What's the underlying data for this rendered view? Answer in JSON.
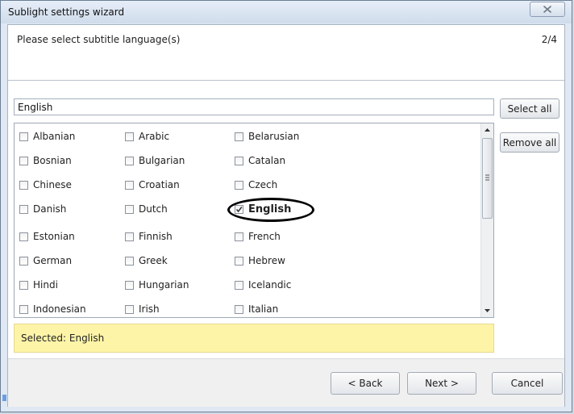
{
  "window": {
    "title": "Sublight settings wizard"
  },
  "header": {
    "text": "Please select subtitle language(s)",
    "step": "2/4"
  },
  "search": {
    "value": "English"
  },
  "buttons": {
    "select_all": "Select all",
    "remove_all": "Remove all",
    "back": "< Back",
    "next": "Next >",
    "cancel": "Cancel"
  },
  "languages": {
    "col1": [
      {
        "label": "Albanian",
        "checked": false
      },
      {
        "label": "Bosnian",
        "checked": false
      },
      {
        "label": "Chinese",
        "checked": false
      },
      {
        "label": "Danish",
        "checked": false
      },
      {
        "label": "Estonian",
        "checked": false
      },
      {
        "label": "German",
        "checked": false
      },
      {
        "label": "Hindi",
        "checked": false
      },
      {
        "label": "Indonesian",
        "checked": false
      }
    ],
    "col2": [
      {
        "label": "Arabic",
        "checked": false
      },
      {
        "label": "Bulgarian",
        "checked": false
      },
      {
        "label": "Croatian",
        "checked": false
      },
      {
        "label": "Dutch",
        "checked": false
      },
      {
        "label": "Finnish",
        "checked": false
      },
      {
        "label": "Greek",
        "checked": false
      },
      {
        "label": "Hungarian",
        "checked": false
      },
      {
        "label": "Irish",
        "checked": false
      }
    ],
    "col3": [
      {
        "label": "Belarusian",
        "checked": false
      },
      {
        "label": "Catalan",
        "checked": false
      },
      {
        "label": "Czech",
        "checked": false
      },
      {
        "label": "English",
        "checked": true
      },
      {
        "label": "French",
        "checked": false
      },
      {
        "label": "Hebrew",
        "checked": false
      },
      {
        "label": "Icelandic",
        "checked": false
      },
      {
        "label": "Italian",
        "checked": false
      }
    ]
  },
  "status": {
    "text": "Selected: English"
  },
  "colors": {
    "status_bg": "#fef4a8",
    "window_bg": "#dfe8f3",
    "highlight_ellipse": "#000000"
  },
  "icons": {
    "close": "close-x-icon",
    "scroll_up": "arrow-up-icon",
    "scroll_down": "arrow-down-icon",
    "scroll_grip": "grip-icon",
    "check": "check-icon"
  }
}
